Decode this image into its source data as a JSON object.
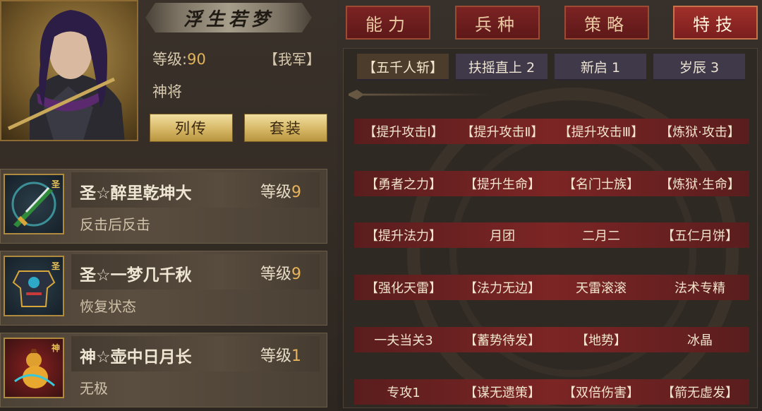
{
  "hero": {
    "name": "浮生若梦",
    "level_label": "等级:",
    "level_value": "90",
    "faction": "【我军】",
    "title": "神将",
    "buttons": {
      "biography": "列传",
      "outfit": "套装"
    }
  },
  "equipment": [
    {
      "name": "圣☆醉里乾坤大",
      "level_label": "等级",
      "level": "9",
      "effect": "反击后反击",
      "badge": "圣",
      "icon": "sword-icon"
    },
    {
      "name": "圣☆一梦几千秋",
      "level_label": "等级",
      "level": "9",
      "effect": "恢复状态",
      "badge": "圣",
      "icon": "armor-icon"
    },
    {
      "name": "神☆壶中日月长",
      "level_label": "等级",
      "level": "1",
      "effect": "无极",
      "badge": "神",
      "icon": "gourd-icon"
    }
  ],
  "tabs": [
    {
      "label": "能力",
      "active": false
    },
    {
      "label": "兵种",
      "active": false
    },
    {
      "label": "策略",
      "active": false
    },
    {
      "label": "特技",
      "active": true
    }
  ],
  "subtabs": [
    {
      "label": "【五千人斩】",
      "active": true
    },
    {
      "label": "扶摇直上 2",
      "active": false
    },
    {
      "label": "新启 1",
      "active": false
    },
    {
      "label": "岁辰 3",
      "active": false
    }
  ],
  "skills": [
    [
      "【提升攻击Ⅰ】",
      "【提升攻击Ⅱ】",
      "【提升攻击Ⅲ】",
      "【炼狱·攻击】"
    ],
    [
      "【勇者之力】",
      "【提升生命】",
      "【名门士族】",
      "【炼狱·生命】"
    ],
    [
      "【提升法力】",
      "月团",
      "二月二",
      "【五仁月饼】"
    ],
    [
      "【强化天雷】",
      "【法力无边】",
      "天雷滚滚",
      "法术专精"
    ],
    [
      "一夫当关3",
      "【蓄势待发】",
      "【地势】",
      "冰晶"
    ],
    [
      "专攻1",
      "【谋无遗策】",
      "【双倍伤害】",
      "【箭无虚发】"
    ]
  ]
}
